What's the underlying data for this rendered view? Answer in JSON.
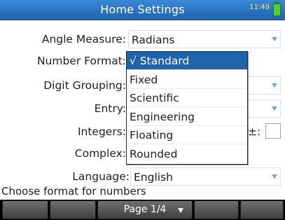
{
  "titlebar": {
    "title": "Home Settings",
    "clock": "11:49",
    "battery_color": "#4fd13b"
  },
  "rows": {
    "angle_measure": {
      "label": "Angle Measure:",
      "value": "Radians"
    },
    "number_format": {
      "label": "Number Format:"
    },
    "digit_grouping": {
      "label": "Digit Grouping:"
    },
    "entry": {
      "label": "Entry:"
    },
    "integers": {
      "label": "Integers:",
      "sign_label": "±:"
    },
    "complex": {
      "label": "Complex:"
    },
    "language": {
      "label": "Language:",
      "value": "English"
    }
  },
  "menu": {
    "items": [
      {
        "label": "√ Standard",
        "selected": true
      },
      {
        "label": "Fixed"
      },
      {
        "label": "Scientific"
      },
      {
        "label": "Engineering"
      },
      {
        "label": "Floating"
      },
      {
        "label": "Rounded"
      }
    ]
  },
  "status": {
    "text": "Choose format for numbers"
  },
  "softkeys": {
    "page_label": "Page 1/4",
    "page_icon": "triangle-down"
  },
  "colors": {
    "title_bar": "#1f63ad",
    "selected_menu": "#1f63ad",
    "clock": "#ffe64a"
  }
}
